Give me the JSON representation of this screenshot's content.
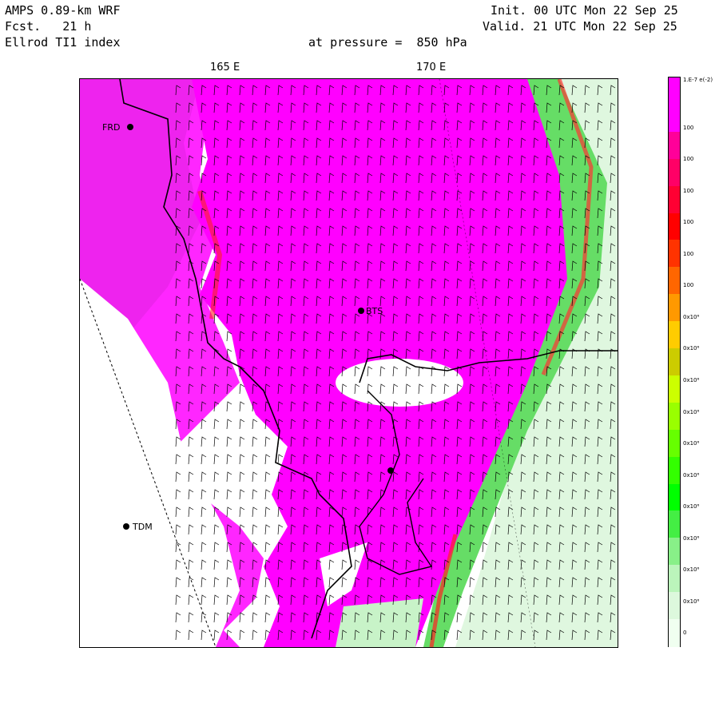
{
  "header": {
    "model": "AMPS 0.89-km WRF",
    "forecast": "Fcst.   21 h",
    "field": "Ellrod TI1 index",
    "level": "at pressure =  850 hPa",
    "init": "Init. 00 UTC Mon 22 Sep 25",
    "valid": "Valid. 21 UTC Mon 22 Sep 25"
  },
  "axis": {
    "lon_labels": [
      "165 E",
      "170 E"
    ]
  },
  "stations": [
    {
      "id": "FRD",
      "label": "FRD"
    },
    {
      "id": "BTS",
      "label": "BTS"
    },
    {
      "id": "TDM",
      "label": "TDM"
    }
  ],
  "colorbar": {
    "top_label": "1.E-7 e(-2)",
    "colors": [
      "#ff00ff",
      "#ff00ff",
      "#ff0099",
      "#ff0066",
      "#ff0033",
      "#ff0000",
      "#ff3300",
      "#ff6600",
      "#ff9900",
      "#ffcc00",
      "#cccc00",
      "#ccff00",
      "#99ff00",
      "#66ff00",
      "#33ff00",
      "#00ff00",
      "#44ee44",
      "#88f088",
      "#bbf5bb",
      "#ddf8dd",
      "#f0fff0"
    ],
    "labels": [
      "100",
      "100",
      "100",
      "100",
      "100",
      "100",
      "0x10⁶",
      "0x10⁶",
      "0x10⁶",
      "0x10⁶",
      "0x10⁶",
      "0x10⁶",
      "0x10⁶",
      "0x10⁶",
      "0x10⁶",
      "0x10⁶",
      "0"
    ]
  },
  "colors": {
    "magenta": "#ff00ff",
    "red": "#ff2222",
    "green": "#33dd33",
    "light_green": "#ccf5cc",
    "coast": "#000000"
  }
}
